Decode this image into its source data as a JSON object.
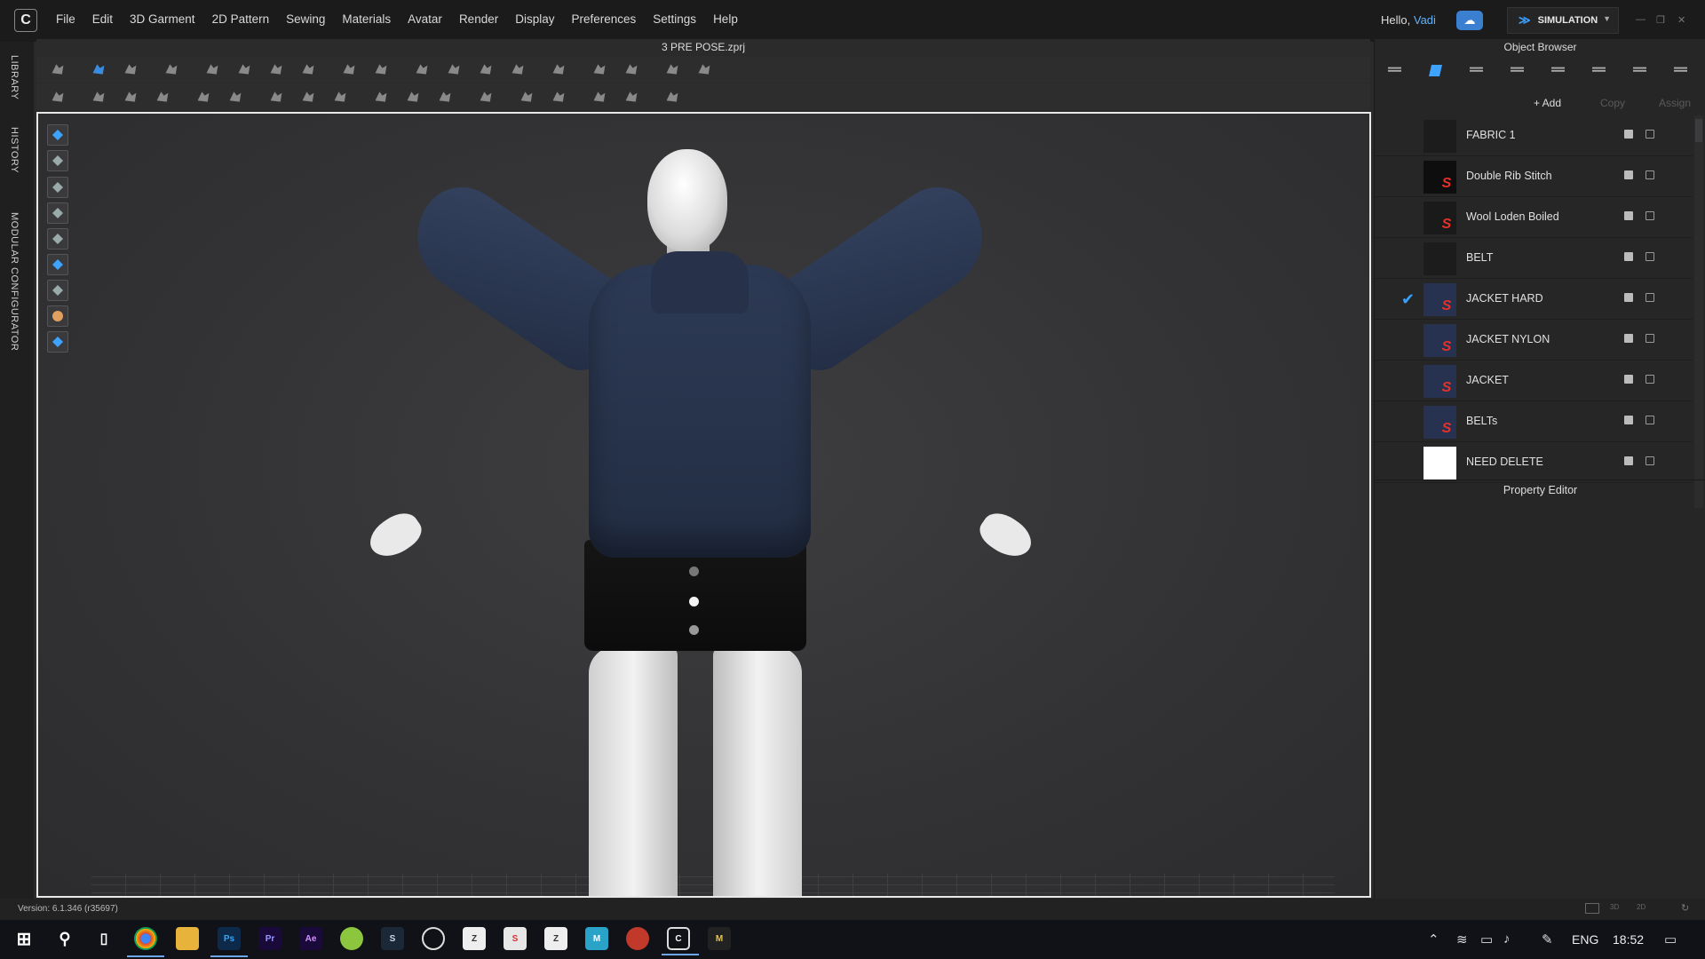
{
  "app": {
    "menu": [
      "File",
      "Edit",
      "3D Garment",
      "2D Pattern",
      "Sewing",
      "Materials",
      "Avatar",
      "Render",
      "Display",
      "Preferences",
      "Settings",
      "Help"
    ],
    "greeting_prefix": "Hello, ",
    "user": "Vadi",
    "mode": "SIMULATION",
    "document_title": "3 PRE POSE.zprj"
  },
  "left_tabs": [
    "LIBRARY",
    "HISTORY",
    "MODULAR CONFIGURATOR"
  ],
  "object_browser": {
    "title": "Object Browser",
    "actions": {
      "add": "+ Add",
      "copy": "Copy",
      "assign": "Assign"
    },
    "materials": [
      {
        "name": "FABRIC 1",
        "thumb": "#1c1c1c",
        "logo": false,
        "checked": false
      },
      {
        "name": "Double Rib Stitch",
        "thumb": "#0e0e0e",
        "logo": true,
        "checked": false
      },
      {
        "name": "Wool Loden Boiled",
        "thumb": "#1a1a1a",
        "logo": true,
        "checked": false
      },
      {
        "name": "BELT",
        "thumb": "#1c1c1c",
        "logo": false,
        "checked": false
      },
      {
        "name": "JACKET HARD",
        "thumb": "#263250",
        "logo": true,
        "checked": true
      },
      {
        "name": "JACKET NYLON",
        "thumb": "#263250",
        "logo": true,
        "checked": false
      },
      {
        "name": "JACKET",
        "thumb": "#263250",
        "logo": true,
        "checked": false
      },
      {
        "name": "BELTs",
        "thumb": "#263250",
        "logo": true,
        "checked": false
      },
      {
        "name": "NEED DELETE",
        "thumb": "#ffffff",
        "logo": false,
        "checked": false
      }
    ]
  },
  "property_editor": {
    "title": "Property Editor"
  },
  "status": {
    "version": "Version: 6.1.346 (r35697)"
  },
  "taskbar": {
    "language": "ENG",
    "time": "18:52"
  },
  "colors": {
    "accent": "#3da3ff",
    "selection_border": "#e8e8e8",
    "jacket": "#2a3650"
  }
}
